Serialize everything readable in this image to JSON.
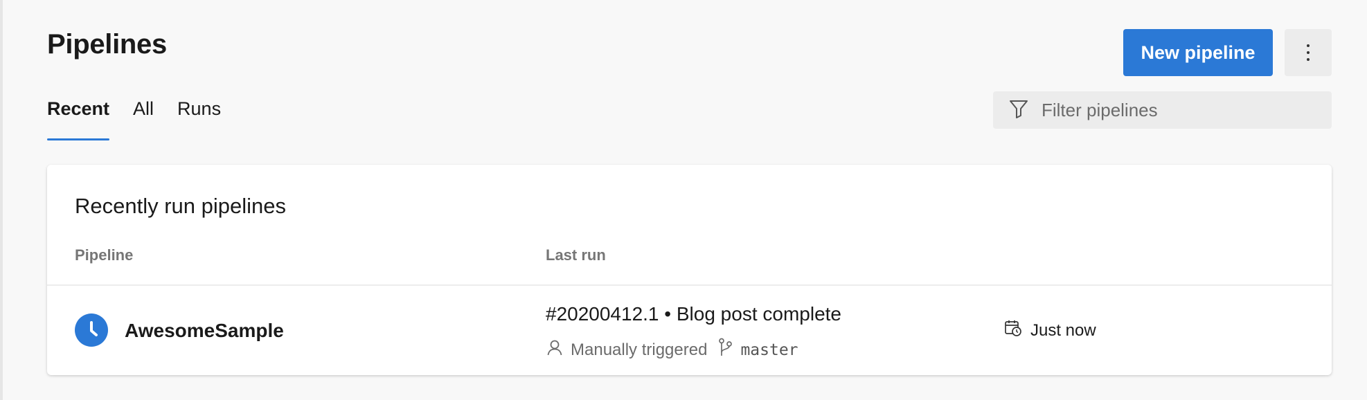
{
  "header": {
    "title": "Pipelines",
    "new_button_label": "New pipeline",
    "more_icon": "vertical-ellipsis-icon"
  },
  "tabs": [
    {
      "label": "Recent",
      "active": true
    },
    {
      "label": "All",
      "active": false
    },
    {
      "label": "Runs",
      "active": false
    }
  ],
  "filter": {
    "placeholder": "Filter pipelines",
    "icon": "filter-funnel-icon"
  },
  "card": {
    "title": "Recently run pipelines",
    "columns": [
      "Pipeline",
      "Last run"
    ],
    "rows": [
      {
        "pipeline": "AwesomeSample",
        "status_icon": "in-progress-clock-icon",
        "run_title": "#20200412.1 • Blog post complete",
        "trigger": "Manually triggered",
        "branch": "master",
        "time": "Just now"
      }
    ]
  },
  "colors": {
    "accent": "#2b79d6",
    "background": "#f8f8f8",
    "card": "#ffffff",
    "muted_text": "#6b6b6b"
  }
}
